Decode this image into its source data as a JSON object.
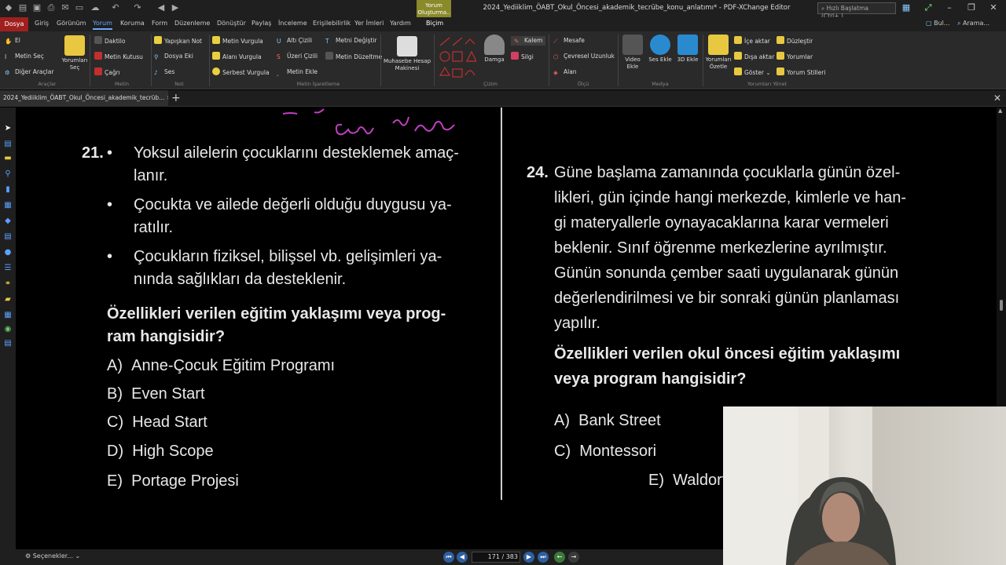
{
  "app": {
    "window_title": "2024_Yediiklim_ÖABT_Okul_Öncesi_akademik_tecrübe_konu_anlatımı* - PDF-XChange Editor",
    "context_tab": "Yorum Oluşturma..",
    "context_sub": "Biçim",
    "quick_search_placeholder": "Hızlı Başlatma (Ctrl+.)",
    "right_tools": [
      "Bul...",
      "Arama..."
    ]
  },
  "menu": {
    "tabs": [
      "Dosya",
      "Giriş",
      "Görünüm",
      "Yorum",
      "Koruma",
      "Form",
      "Düzenleme",
      "Dönüştür",
      "Paylaş",
      "İnceleme",
      "Erişilebilirlik",
      "Yer İmleri",
      "Yardım",
      "Biçim"
    ],
    "active": "Yorum"
  },
  "ribbon": {
    "araclar": {
      "label": "Araçlar",
      "items": [
        "El",
        "Metin Seç",
        "Diğer Araçlar"
      ],
      "big": "Yorumları Seç"
    },
    "metin": {
      "label": "Metin",
      "items": [
        "Daktilo",
        "Metin Kutusu",
        "Çağrı"
      ]
    },
    "not": {
      "label": "Not",
      "items": [
        "Yapışkan Not",
        "Dosya Eki",
        "Ses"
      ]
    },
    "metin_isaretleme": {
      "label": "Metin İşaretleme",
      "items": [
        "Metin Vurgula",
        "Alanı Vurgula",
        "Serbest Vurgula",
        "Altı Çizili",
        "Üzeri Çizili",
        "Metin Ekle",
        "Metni Değiştir",
        "Metin Düzeltme"
      ]
    },
    "muhasebe": "Muhasebe Hesap Makinesi",
    "cizim": {
      "label": "Çizim",
      "damga": "Damga",
      "items": [
        "Kalem",
        "Silgi"
      ]
    },
    "olcu": {
      "label": "Ölçü",
      "items": [
        "Mesafe",
        "Çevresel Uzunluk",
        "Alan"
      ]
    },
    "medya": {
      "label": "Medya",
      "items": [
        "Video Ekle",
        "Ses Ekle",
        "3D Ekle"
      ]
    },
    "yorumlari_yonet": {
      "label": "Yorumları Yönet",
      "big": "Yorumları Özetle",
      "items": [
        "İçe aktar",
        "Dışa aktar",
        "Göster",
        "Düzleştir",
        "Yorumlar",
        "Yorum Stilleri"
      ]
    }
  },
  "doc_tab": "2024_Yediiklim_ÖABT_Okul_Öncesi_akademik_tecrüb...",
  "q21": {
    "number": "21.",
    "bullets": [
      [
        "Yoksul ailelerin çocuklarını desteklemek amaç-",
        "lanır."
      ],
      [
        "Çocukta ve ailede değerli olduğu duygusu ya-",
        "ratılır."
      ],
      [
        "Çocukların fiziksel, bilişsel vb. gelişimleri ya-",
        "nında sağlıkları da desteklenir."
      ]
    ],
    "prompt": [
      "Özellikleri verilen eğitim yaklaşımı veya prog-",
      "ram hangisidir?"
    ],
    "options": [
      {
        "key": "A)",
        "text": "Anne-Çocuk Eğitim Programı"
      },
      {
        "key": "B)",
        "text": "Even Start"
      },
      {
        "key": "C)",
        "text": "Head Start"
      },
      {
        "key": "D)",
        "text": "High Scope"
      },
      {
        "key": "E)",
        "text": "Portage Projesi"
      }
    ]
  },
  "q24": {
    "number": "24.",
    "lines": [
      "Güne başlama zamanında çocuklarla günün özel-",
      "likleri, gün içinde hangi merkezde, kimlerle ve han-",
      "gi materyallerle oynayacaklarına karar vermeleri",
      "beklenir. Sınıf öğrenme merkezlerine ayrılmıştır.",
      "Günün sonunda çember saati uygulanarak günün",
      "değerlendirilmesi ve bir sonraki günün planlaması",
      "yapılır."
    ],
    "prompt": [
      "Özellikleri verilen okul öncesi eğitim yaklaşımı",
      "veya program hangisidir?"
    ],
    "options": [
      {
        "key": "A)",
        "text": "Bank Street"
      },
      {
        "key": "C)",
        "text": "Montessori"
      },
      {
        "key": "E)",
        "text": "Waldorf"
      }
    ]
  },
  "status": {
    "options_label": "Seçenekler...",
    "page_current": "171",
    "page_total": "383"
  },
  "colors": {
    "menu_active": "#a02020",
    "context_tab": "#8a8a2a",
    "link_blue": "#6aaaff",
    "ink": "#c040c0"
  }
}
